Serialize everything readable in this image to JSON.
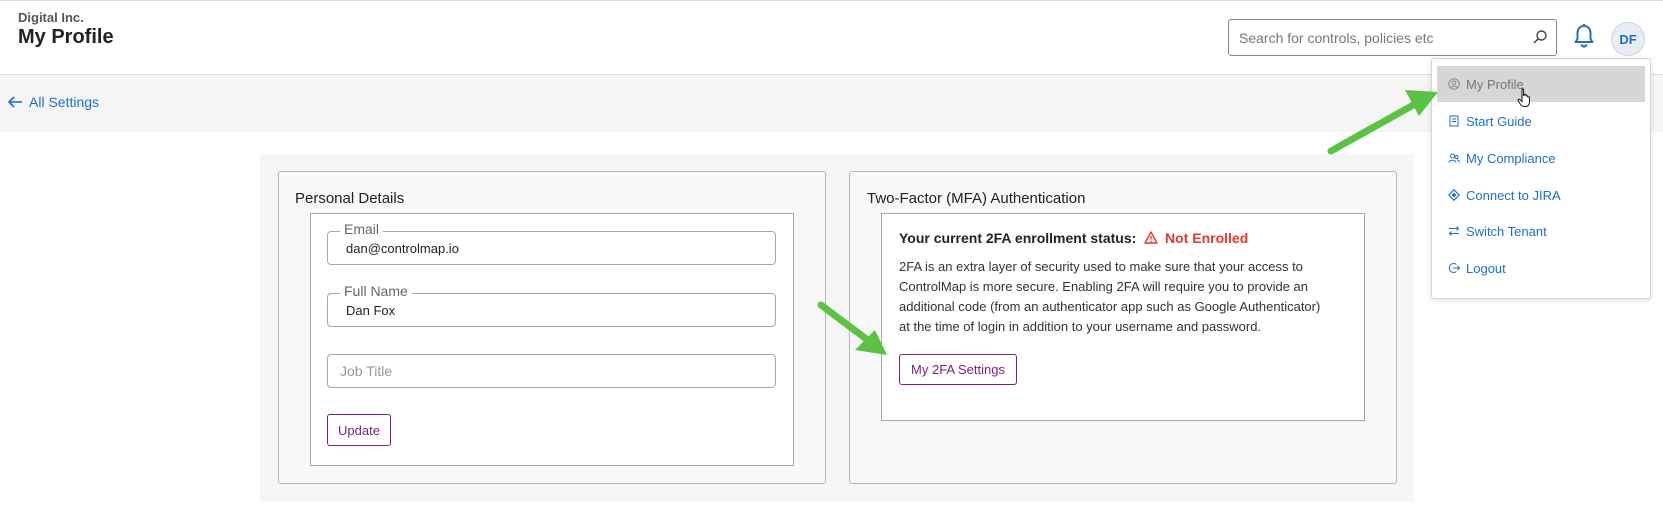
{
  "header": {
    "org_name": "Digital Inc.",
    "page_title": "My Profile",
    "search_placeholder": "Search for controls, policies etc",
    "avatar_initials": "DF"
  },
  "subbar": {
    "back_label": "All Settings"
  },
  "personal": {
    "title": "Personal Details",
    "email_label": "Email",
    "email_value": "dan@controlmap.io",
    "fullname_label": "Full Name",
    "fullname_value": "Dan Fox",
    "jobtitle_placeholder": "Job Title",
    "update_label": "Update"
  },
  "mfa": {
    "title": "Two-Factor (MFA) Authentication",
    "status_prefix": "Your current 2FA enrollment status:",
    "status_value": "Not Enrolled",
    "description": "2FA is an extra layer of security used to make sure that your access to ControlMap is more secure. Enabling 2FA will require you to provide an additional code (from an authenticator app such as Google Authenticator) at the time of login in addition to your username and password.",
    "settings_button": "My 2FA Settings"
  },
  "menu": {
    "items": [
      {
        "label": "My Profile",
        "icon": "user-circle-icon",
        "active": true
      },
      {
        "label": "Start Guide",
        "icon": "book-icon",
        "active": false
      },
      {
        "label": "My Compliance",
        "icon": "users-icon",
        "active": false
      },
      {
        "label": "Connect to JIRA",
        "icon": "jira-icon",
        "active": false
      },
      {
        "label": "Switch Tenant",
        "icon": "switch-icon",
        "active": false
      },
      {
        "label": "Logout",
        "icon": "logout-icon",
        "active": false
      }
    ]
  },
  "colors": {
    "accent_blue": "#1f6fc7",
    "button_purple": "#7a1f7a",
    "status_red": "#e03a2a",
    "annotation_green": "#5cc245"
  }
}
